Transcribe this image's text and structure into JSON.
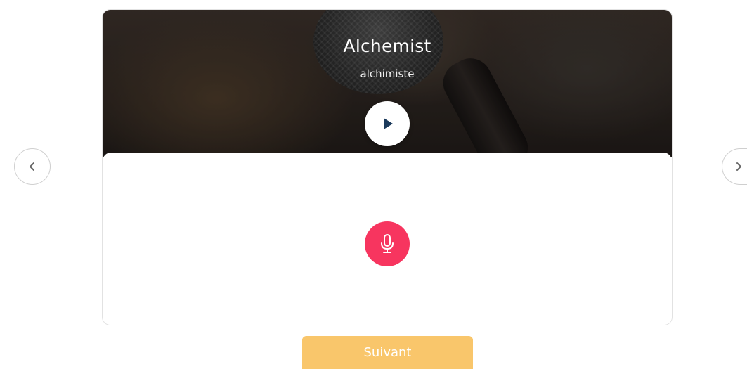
{
  "card": {
    "title": "Alchemist",
    "subtitle": "alchimiste",
    "hero_image": "microphone-photo"
  },
  "controls": {
    "play_icon": "play-icon",
    "record_icon": "microphone-icon",
    "prev_icon": "chevron-left-icon",
    "next_icon": "chevron-right-icon"
  },
  "footer": {
    "next_label": "Suivant"
  },
  "colors": {
    "record": "#f7355f",
    "next_button": "#f9c66b",
    "play_triangle": "#1b3a5c"
  }
}
